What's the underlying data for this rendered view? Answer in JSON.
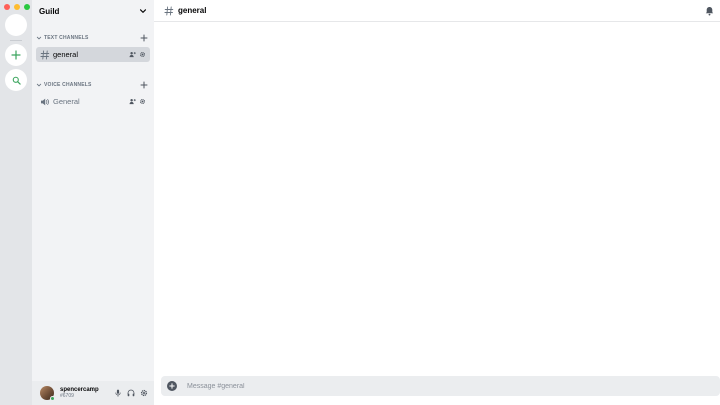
{
  "window": {
    "traffic_lights": [
      "close",
      "minimize",
      "maximize"
    ]
  },
  "guild_rail": {
    "items": [
      {
        "icon": "guild-icon"
      },
      {
        "icon": "plus-icon",
        "color": "#3ba55d"
      },
      {
        "icon": "search-icon",
        "color": "#3ba55d"
      }
    ]
  },
  "sidebar": {
    "guild_name": "Guild",
    "categories": [
      {
        "label": "TEXT CHANNELS",
        "channels": [
          {
            "name": "general",
            "icon": "hash-icon",
            "selected": true
          }
        ]
      },
      {
        "label": "VOICE CHANNELS",
        "channels": [
          {
            "name": "General",
            "icon": "speaker-icon",
            "selected": false
          }
        ]
      }
    ]
  },
  "user_panel": {
    "username": "spencercamp",
    "discriminator": "#6709",
    "status_color": "#3ba55d"
  },
  "main": {
    "channel_title": "general",
    "composer_placeholder": "Message #general"
  },
  "colors": {
    "rail_bg": "#e3e5e8",
    "sidebar_bg": "#f2f3f5",
    "selected_channel_bg": "#d4d7dc",
    "accent_green": "#3ba55d"
  }
}
